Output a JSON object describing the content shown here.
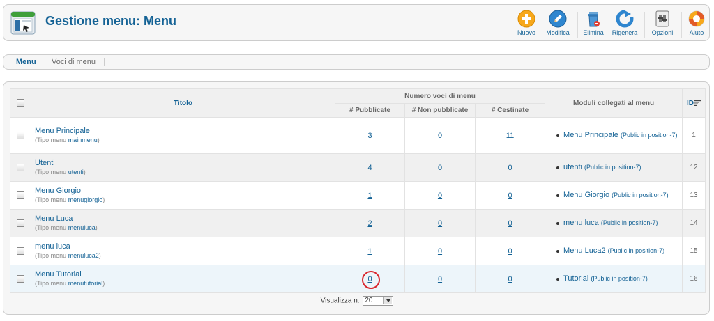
{
  "header": {
    "title": "Gestione menu: Menu",
    "app_icon": "menu-manager-icon"
  },
  "toolbar": {
    "buttons": [
      {
        "label": "Nuovo",
        "icon": "new-plus-icon",
        "color": "#f5a623"
      },
      {
        "label": "Modifica",
        "icon": "edit-pencil-icon",
        "color": "#2a7fc9"
      },
      {
        "label": "Elimina",
        "icon": "trash-icon",
        "color": "#3a8fd0"
      },
      {
        "label": "Rigenera",
        "icon": "refresh-icon",
        "color": "#3a8fd0"
      },
      {
        "label": "Opzioni",
        "icon": "options-icon",
        "color": "#777777"
      },
      {
        "label": "Aiuto",
        "icon": "help-lifebuoy-icon",
        "color": "#e05a2a"
      }
    ]
  },
  "submenu": {
    "tabs": [
      {
        "label": "Menu",
        "active": true
      },
      {
        "label": "Voci di menu",
        "active": false
      }
    ]
  },
  "table": {
    "headers": {
      "title": "Titolo",
      "group": "Numero voci di menu",
      "published": "# Pubblicate",
      "unpublished": "# Non pubblicate",
      "trashed": "# Cestinate",
      "modules": "Moduli collegati al menu",
      "id": "ID"
    },
    "type_prefix": "(Tipo menu ",
    "type_suffix": ")",
    "rows": [
      {
        "title": "Menu Principale",
        "type": "mainmenu",
        "published": "3",
        "unpublished": "0",
        "trashed": "11",
        "module": "Menu Principale",
        "module_pos": "(Public in position-7)",
        "id": "1"
      },
      {
        "title": "Utenti",
        "type": "utenti",
        "published": "4",
        "unpublished": "0",
        "trashed": "0",
        "module": "utenti",
        "module_pos": "(Public in position-7)",
        "id": "12"
      },
      {
        "title": "Menu Giorgio",
        "type": "menugiorgio",
        "published": "1",
        "unpublished": "0",
        "trashed": "0",
        "module": "Menu Giorgio",
        "module_pos": "(Public in position-7)",
        "id": "13"
      },
      {
        "title": "Menu Luca",
        "type": "menuluca",
        "published": "2",
        "unpublished": "0",
        "trashed": "0",
        "module": "menu luca",
        "module_pos": "(Public in position-7)",
        "id": "14"
      },
      {
        "title": "menu luca",
        "type": "menuluca2",
        "published": "1",
        "unpublished": "0",
        "trashed": "0",
        "module": "Menu Luca2",
        "module_pos": "(Public in position-7)",
        "id": "15"
      },
      {
        "title": "Menu Tutorial",
        "type": "menututorial",
        "published": "0",
        "unpublished": "0",
        "trashed": "0",
        "module": "Tutorial",
        "module_pos": "(Public in position-7)",
        "id": "16"
      }
    ]
  },
  "footer": {
    "display_label": "Visualizza n.",
    "limit_value": "20"
  },
  "colors": {
    "accent": "#146295",
    "highlight_circle": "#d9272e"
  }
}
